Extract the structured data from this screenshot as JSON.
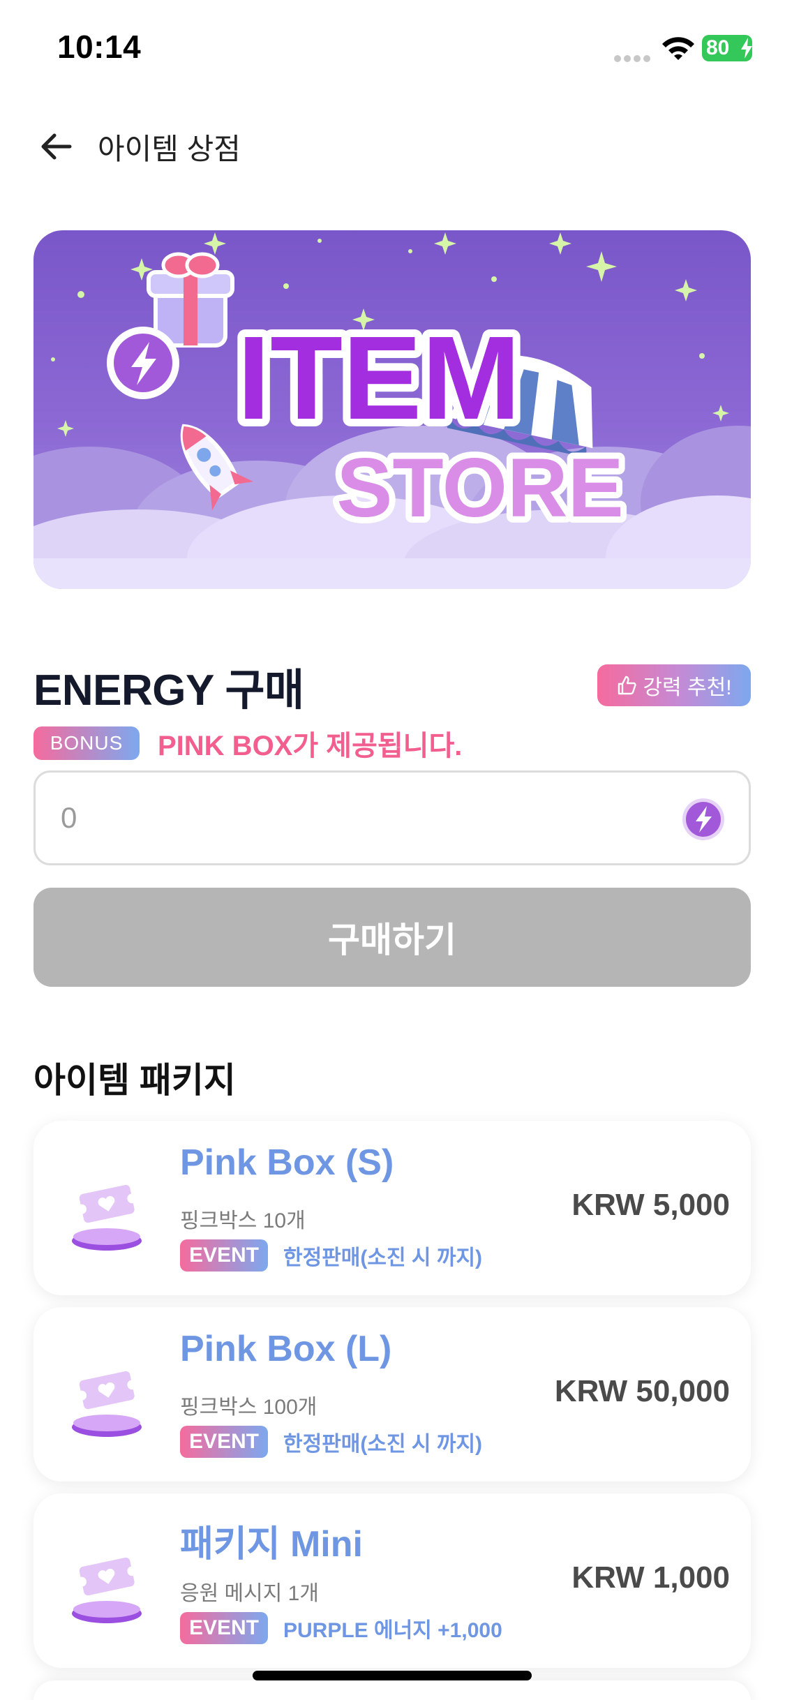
{
  "status_bar": {
    "time": "10:14",
    "battery": "80"
  },
  "header": {
    "title": "아이템 상점"
  },
  "banner": {
    "line1": "ITEM",
    "line2": "STORE"
  },
  "energy": {
    "title": "ENERGY 구매",
    "recommend_badge": "강력 추천!",
    "bonus_badge": "BONUS",
    "bonus_text": "PINK BOX가 제공됩니다.",
    "input_value": "0",
    "buy_button": "구매하기"
  },
  "packages": {
    "title": "아이템 패키지",
    "items": [
      {
        "name": "Pink Box (S)",
        "desc": "핑크박스 10개",
        "event_badge": "EVENT",
        "event_text": "한정판매(소진 시 까지)",
        "price": "KRW 5,000"
      },
      {
        "name": "Pink Box (L)",
        "desc": "핑크박스 100개",
        "event_badge": "EVENT",
        "event_text": "한정판매(소진 시 까지)",
        "price": "KRW 50,000"
      },
      {
        "name": "패키지 Mini",
        "desc": "응원 메시지 1개",
        "event_badge": "EVENT",
        "event_text": "PURPLE 에너지 +1,000",
        "price": "KRW 1,000"
      }
    ]
  },
  "colors": {
    "accent_blue": "#6e96e3",
    "accent_pink": "#f25f8e",
    "banner_purple": "#7a57c9",
    "button_disabled": "#b5b5b5"
  }
}
